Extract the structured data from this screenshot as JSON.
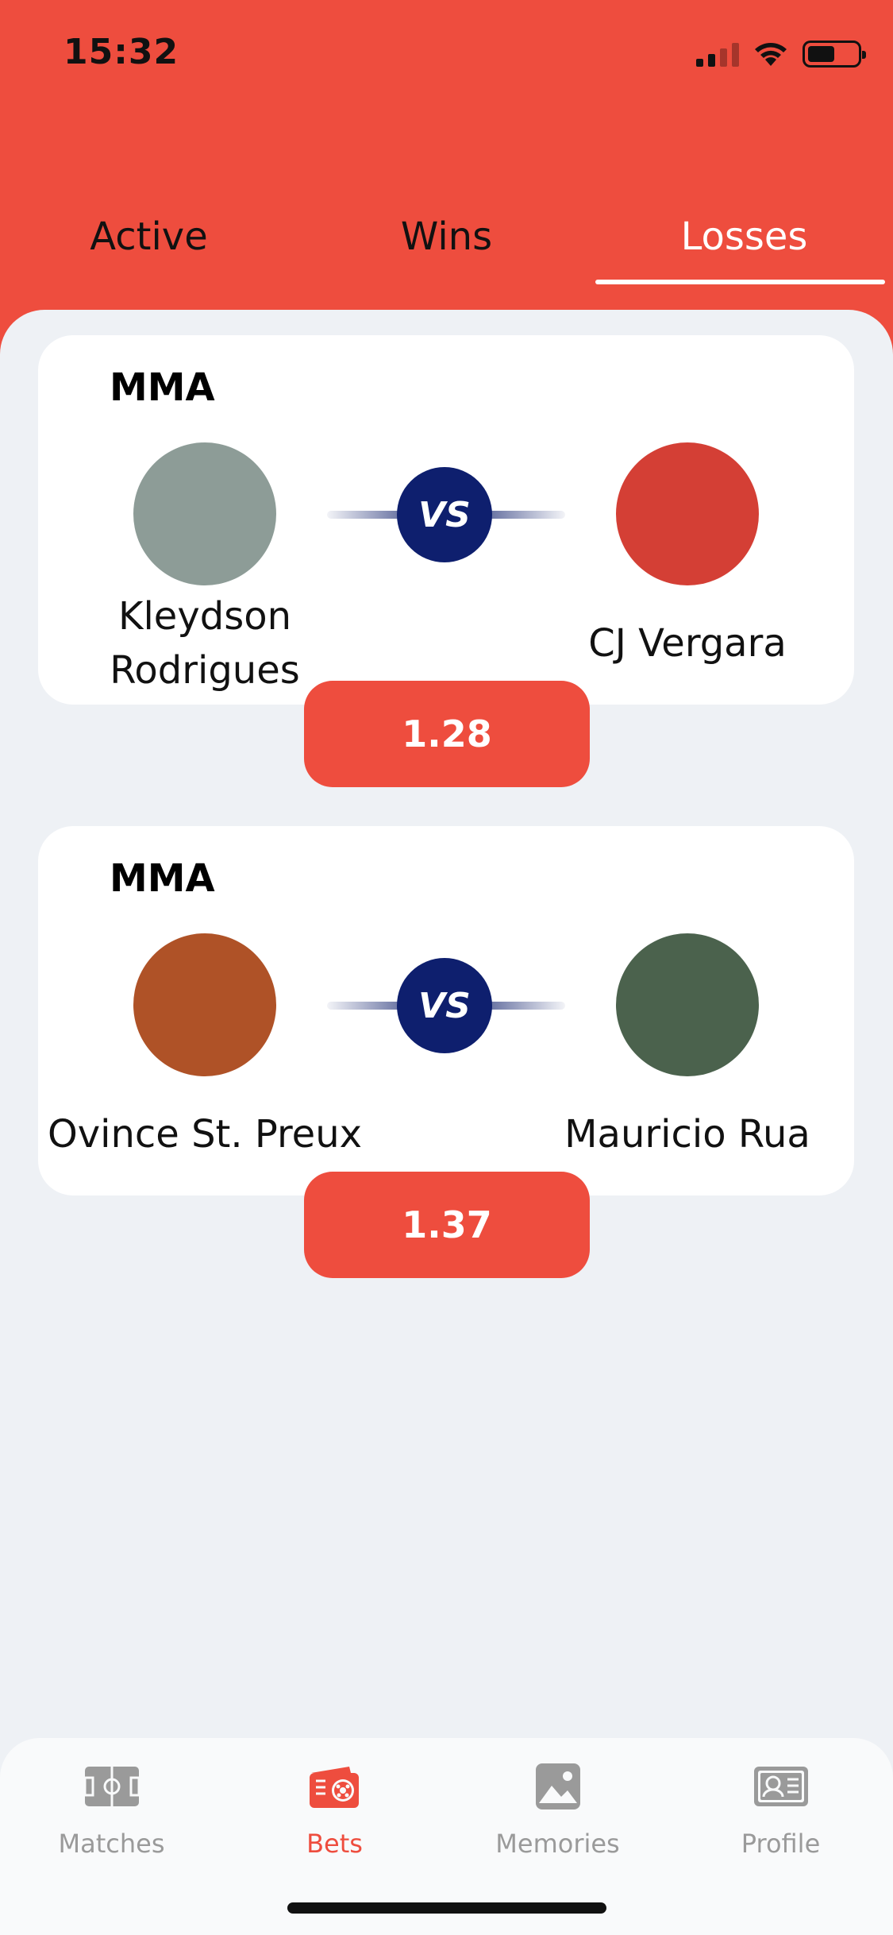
{
  "status_bar": {
    "time": "15:32",
    "battery_level": 0.55
  },
  "tabs": [
    {
      "label": "Active",
      "active": false
    },
    {
      "label": "Wins",
      "active": false
    },
    {
      "label": "Losses",
      "active": true
    }
  ],
  "bets": [
    {
      "sport": "MMA",
      "vs_label": "VS",
      "fighter_left": {
        "name": "Kleydson Rodrigues",
        "color": "#8D9C97"
      },
      "fighter_right": {
        "name": "CJ Vergara",
        "color": "#D43F35"
      },
      "odds": "1.28"
    },
    {
      "sport": "MMA",
      "vs_label": "VS",
      "fighter_left": {
        "name": "Ovince St. Preux",
        "color": "#AF5227"
      },
      "fighter_right": {
        "name": "Mauricio Rua",
        "color": "#4B624D"
      },
      "odds": "1.37"
    }
  ],
  "bottom_nav": [
    {
      "label": "Matches",
      "icon": "field-icon",
      "active": false
    },
    {
      "label": "Bets",
      "icon": "ticket-ball-icon",
      "active": true
    },
    {
      "label": "Memories",
      "icon": "image-icon",
      "active": false
    },
    {
      "label": "Profile",
      "icon": "id-card-icon",
      "active": false
    }
  ],
  "colors": {
    "accent": "#EE4D3E",
    "vs_badge": "#0E1F6E",
    "panel_bg": "#EEF1F5",
    "nav_inactive": "#9A9A9A"
  }
}
